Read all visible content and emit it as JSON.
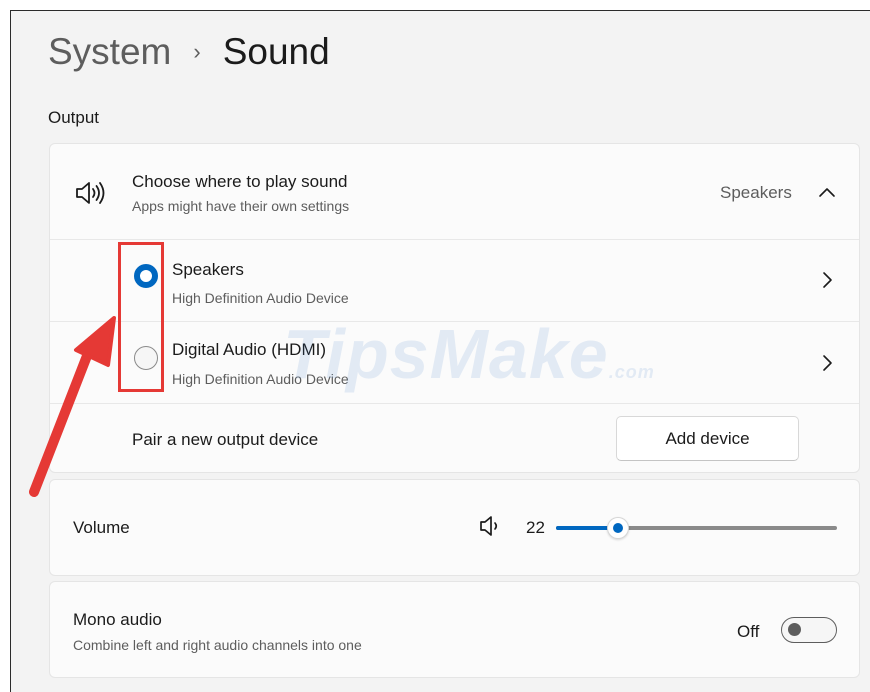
{
  "breadcrumb": {
    "parent": "System",
    "separator": "›",
    "current": "Sound"
  },
  "output": {
    "section_label": "Output",
    "choose": {
      "title": "Choose where to play sound",
      "subtitle": "Apps might have their own settings",
      "selected_value": "Speakers",
      "icon": "speaker-icon"
    },
    "devices": [
      {
        "name": "Speakers",
        "description": "High Definition Audio Device",
        "selected": true
      },
      {
        "name": "Digital Audio (HDMI)",
        "description": "High Definition Audio Device",
        "selected": false
      }
    ],
    "pair": {
      "label": "Pair a new output device",
      "button_label": "Add device"
    }
  },
  "volume": {
    "label": "Volume",
    "value": "22",
    "level": 0.22
  },
  "mono": {
    "title": "Mono audio",
    "subtitle": "Combine left and right audio channels into one",
    "state_label": "Off",
    "on": false
  },
  "watermark": {
    "text": "TipsMake",
    "suffix": ".com"
  },
  "colors": {
    "accent": "#0067c0",
    "annotation_red": "#e53935",
    "background": "#f3f3f3"
  }
}
